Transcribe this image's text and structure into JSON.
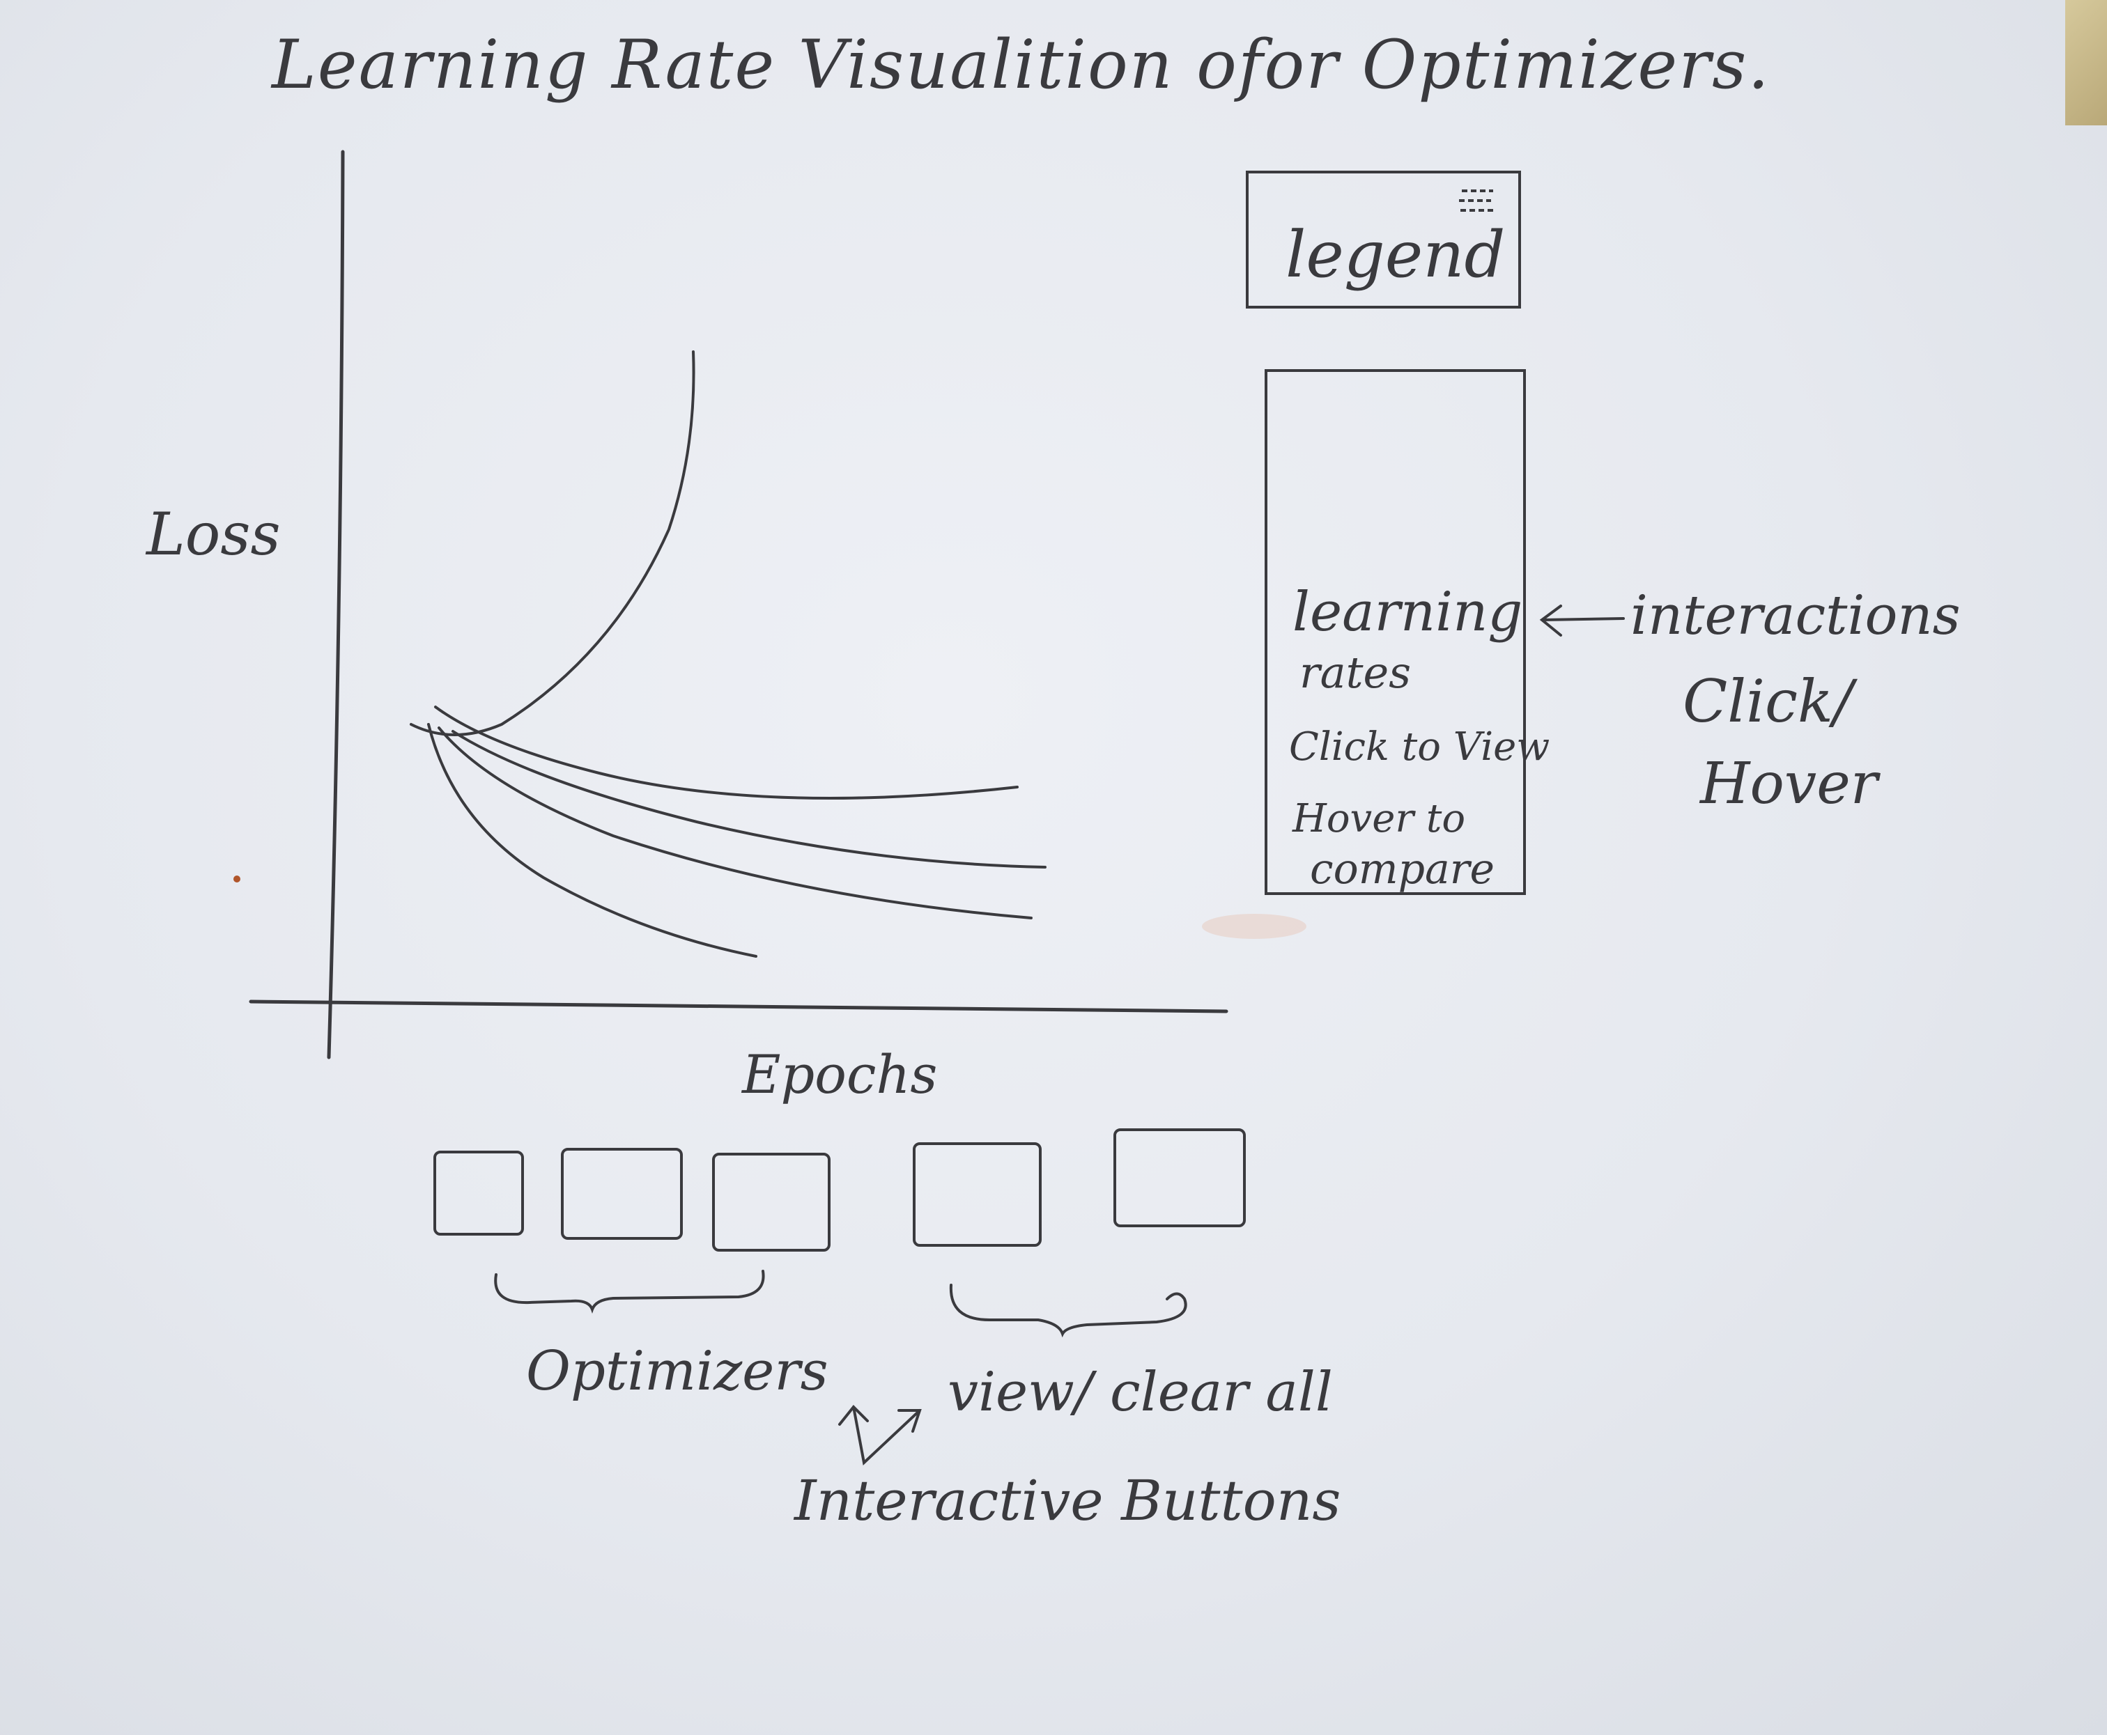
{
  "title": "Learning Rate Visualition ofor Optimizers.",
  "chart": {
    "ylabel": "Loss",
    "xlabel": "Epochs"
  },
  "legend": {
    "label": "legend",
    "icon": "menu-lines-icon"
  },
  "rates_panel": {
    "line1": "learning",
    "line2": "rates",
    "line3": "Click to View",
    "line4": "Hover to",
    "line5": "compare"
  },
  "annotations": {
    "interactions": "interactions",
    "click": "Click/",
    "hover": "Hover",
    "optimizers": "Optimizers",
    "view_clear": "view/ clear all",
    "interactive_buttons": "Interactive Buttons"
  },
  "colors": {
    "pencil": "#3a3a3e",
    "paper": "#e6e9ef"
  }
}
